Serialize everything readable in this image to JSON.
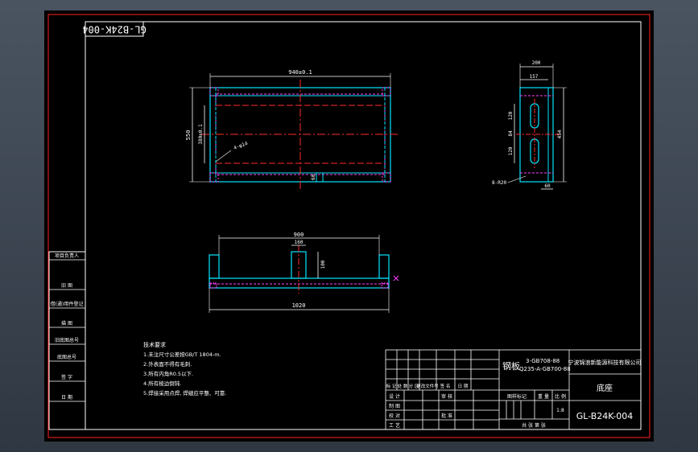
{
  "drawing": {
    "number": "GL-B24K-004",
    "number_rotated": "GL-B24K-004",
    "part_name": "底座",
    "company": "宁波锦浪新能源科技有限公司",
    "material_line1": "钢板",
    "material_line2": "3-GB708-88",
    "material_line3": "Q235-A-GB700-88",
    "scale": "1:8",
    "scale_label": "比 例",
    "stage_label": "图样标记",
    "weight_label": "重 量",
    "sheets_label": "共   张   第   张"
  },
  "revision_header": [
    "标 记",
    "处 数",
    "分 区",
    "更改文件号",
    "签 名",
    "日 期"
  ],
  "approval_labels": [
    "设 计",
    "审 核",
    "制 图",
    "校 对",
    "批 准",
    "工 艺"
  ],
  "left_strip_labels": [
    "项目负责人",
    "旧 图",
    "借(通)用件登记",
    "描 图",
    "旧底图总号",
    "底图总号",
    "签 字",
    "日 期"
  ],
  "tech_notes": {
    "title": "技术要求",
    "items": [
      "1.未注尺寸公差按GB/T 1804-m.",
      "2.外表面不得有毛刺.",
      "3.所有内角R0.5以下.",
      "4.所有棱边倒钝.",
      "5.焊接采用点焊, 焊缝应平整、可靠."
    ]
  },
  "dimensions": {
    "top_width": "940±0.1",
    "top_height": "550",
    "top_inner_height": "380±0.1",
    "top_holes": "4-φ14",
    "top_small": "60",
    "front_total": "1020",
    "front_inner": "900",
    "front_rib": "160",
    "front_rib_height": "100",
    "side_width": "200",
    "side_offset": "157",
    "side_slot1": "120",
    "side_slot2": "84",
    "side_slot3": "120",
    "side_height": "454",
    "side_bottom": "60",
    "side_holes": "8-R20"
  },
  "colors": {
    "background": "#000000",
    "border": "#ffffff",
    "outer_border": "#ff2020",
    "outline": "#00e5ff",
    "centerline": "#ff2a2a",
    "hidden": "#ff40ff",
    "dimension": "#ffffff",
    "table": "#ffffff"
  }
}
